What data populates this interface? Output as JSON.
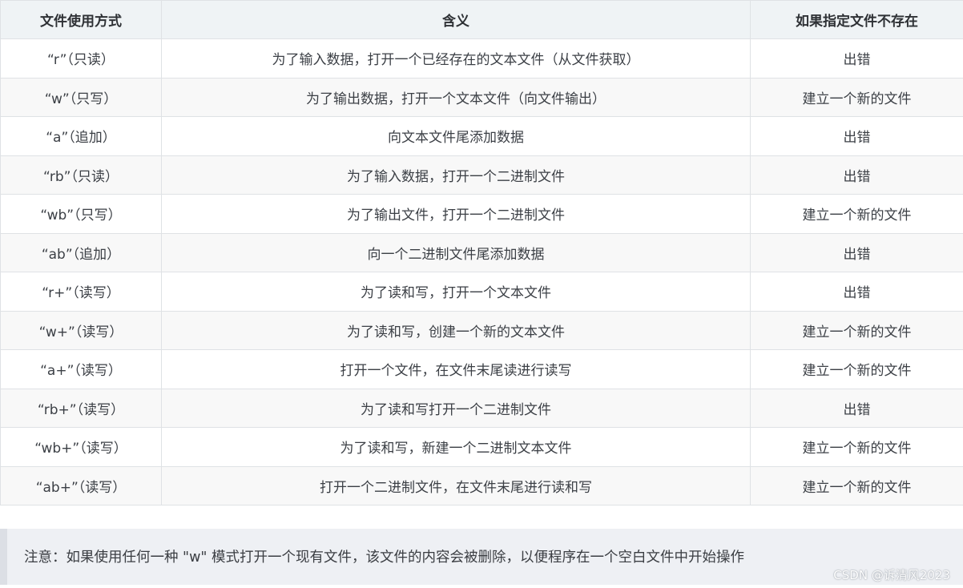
{
  "table": {
    "headers": [
      "文件使用方式",
      "含义",
      "如果指定文件不存在"
    ],
    "rows": [
      [
        "“r”（只读）",
        "为了输入数据，打开一个已经存在的文本文件（从文件获取）",
        "出错"
      ],
      [
        "“w”（只写）",
        "为了输出数据，打开一个文本文件（向文件输出）",
        "建立一个新的文件"
      ],
      [
        "“a”（追加）",
        "向文本文件尾添加数据",
        "出错"
      ],
      [
        "“rb”（只读）",
        "为了输入数据，打开一个二进制文件",
        "出错"
      ],
      [
        "“wb”（只写）",
        "为了输出文件，打开一个二进制文件",
        "建立一个新的文件"
      ],
      [
        "“ab”（追加）",
        "向一个二进制文件尾添加数据",
        "出错"
      ],
      [
        "“r+”（读写）",
        "为了读和写，打开一个文本文件",
        "出错"
      ],
      [
        "“w+”（读写）",
        "为了读和写，创建一个新的文本文件",
        "建立一个新的文件"
      ],
      [
        "“a+”（读写）",
        "打开一个文件，在文件末尾读进行读写",
        "建立一个新的文件"
      ],
      [
        "“rb+”（读写）",
        "为了读和写打开一个二进制文件",
        "出错"
      ],
      [
        "“wb+”（读写）",
        "为了读和写，新建一个二进制文本文件",
        "建立一个新的文件"
      ],
      [
        "“ab+”（读写）",
        "打开一个二进制文件，在文件末尾进行读和写",
        "建立一个新的文件"
      ]
    ]
  },
  "note": {
    "text": "注意：如果使用任何一种 \"w\" 模式打开一个现有文件，该文件的内容会被删除，以便程序在一个空白文件中开始操作"
  },
  "watermark": "CSDN @诉清风2023"
}
